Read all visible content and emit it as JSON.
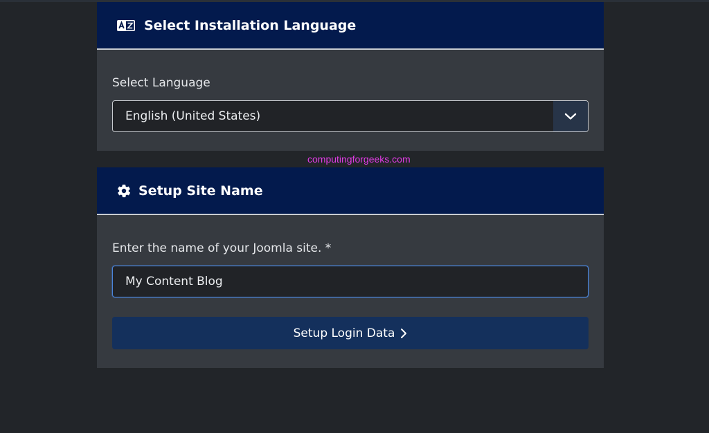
{
  "language_card": {
    "title": "Select Installation Language",
    "icon": "language-icon",
    "label": "Select Language",
    "selected_language": "English (United States)"
  },
  "watermark": "computingforgeeks.com",
  "site_card": {
    "title": "Setup Site Name",
    "icon": "gear-icon",
    "label": "Enter the name of your Joomla site. *",
    "site_name_value": "My Content Blog",
    "next_button_label": "Setup Login Data"
  },
  "colors": {
    "header_bg": "#031a4d",
    "card_bg": "#363a40",
    "page_bg": "#222529",
    "button_bg": "#14305c",
    "focus_border": "#4a84d9",
    "watermark": "#e23ce5"
  }
}
